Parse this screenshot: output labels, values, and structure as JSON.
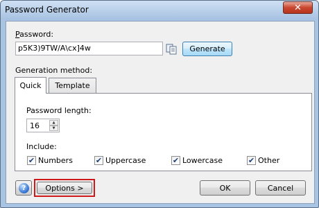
{
  "window": {
    "title": "Password Generator",
    "close_glyph": "✕"
  },
  "password": {
    "label_ul": "P",
    "label_rest": "assword:",
    "value": "p5K3)9TW/A\\cx]4w"
  },
  "buttons": {
    "generate": "Generate",
    "options": "Options >",
    "ok": "OK",
    "cancel": "Cancel",
    "help": "?"
  },
  "generation": {
    "label": "Generation method:",
    "tabs": [
      {
        "label": "Quick"
      },
      {
        "label": "Template"
      }
    ],
    "length_label": "Password length:",
    "length_value": "16",
    "include_label": "Include:",
    "options": [
      {
        "label": "Numbers",
        "checked": true
      },
      {
        "label": "Uppercase",
        "checked": true
      },
      {
        "label": "Lowercase",
        "checked": true
      },
      {
        "label": "Other",
        "checked": true
      }
    ]
  },
  "icons": {
    "copy": "copy-icon",
    "help": "help-icon",
    "spin_up": "▲",
    "spin_down": "▼"
  },
  "colors": {
    "highlight": "#d01717",
    "title_bar": "#a7c2e2",
    "face": "#f0f0f0"
  }
}
